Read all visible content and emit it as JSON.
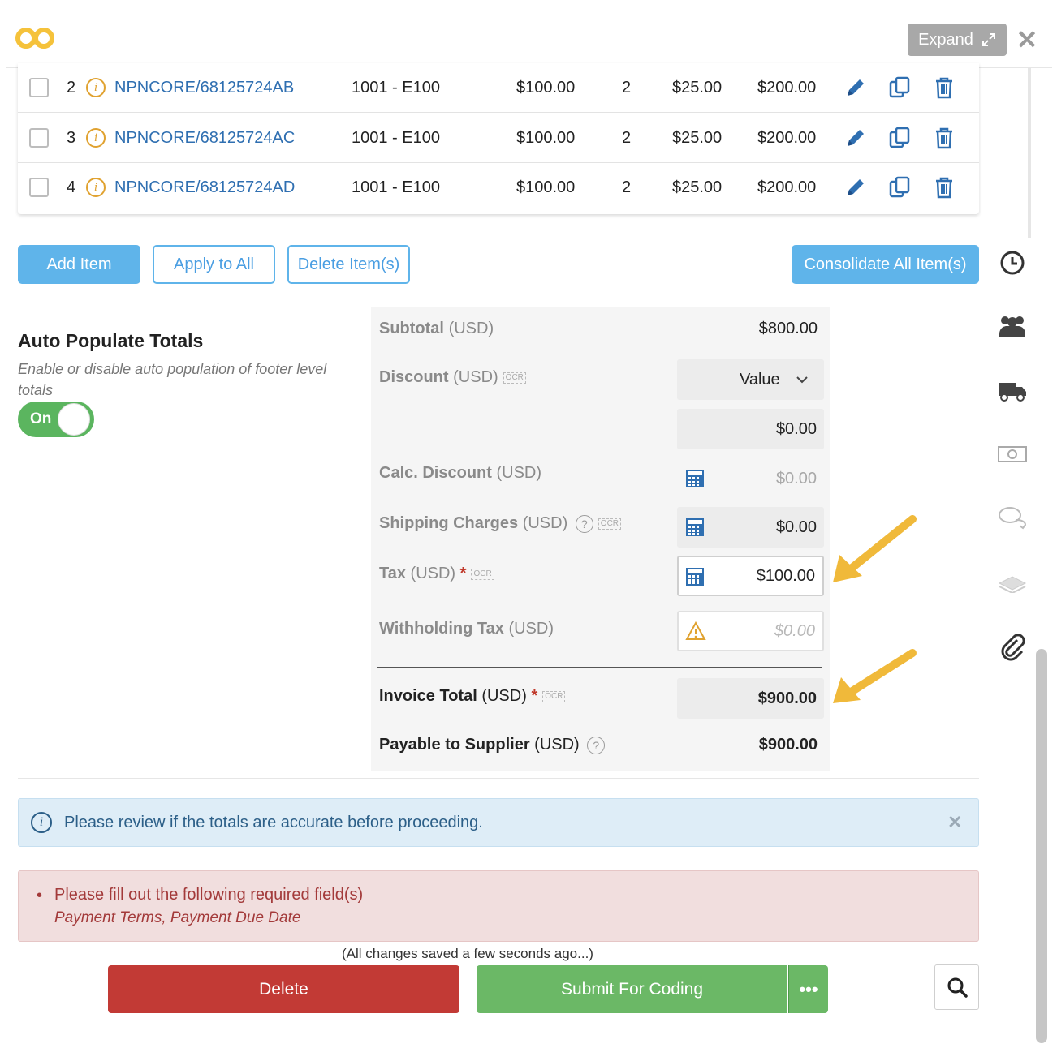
{
  "header": {
    "expand_label": "Expand",
    "icons": {
      "logo": "infinity-logo",
      "expand": "expand-arrows-icon",
      "close": "close-icon"
    }
  },
  "items": [
    {
      "num": "2",
      "ref": "NPNCORE/68125724AB",
      "account": "1001 - E100",
      "price": "$100.00",
      "qty": "2",
      "unit": "$25.00",
      "total": "$200.00"
    },
    {
      "num": "3",
      "ref": "NPNCORE/68125724AC",
      "account": "1001 - E100",
      "price": "$100.00",
      "qty": "2",
      "unit": "$25.00",
      "total": "$200.00"
    },
    {
      "num": "4",
      "ref": "NPNCORE/68125724AD",
      "account": "1001 - E100",
      "price": "$100.00",
      "qty": "2",
      "unit": "$25.00",
      "total": "$200.00"
    }
  ],
  "actions": {
    "add_item": "Add Item",
    "apply_to_all": "Apply to All",
    "delete_items": "Delete Item(s)",
    "consolidate": "Consolidate All Item(s)"
  },
  "auto_populate": {
    "title": "Auto Populate Totals",
    "description": "Enable or disable auto population of footer level totals",
    "toggle_label": "On"
  },
  "totals": {
    "subtotal_label": "Subtotal",
    "subtotal_currency": "(USD)",
    "subtotal_value": "$800.00",
    "discount_label": "Discount",
    "discount_currency": "(USD)",
    "discount_type": "Value",
    "discount_value": "$0.00",
    "calc_discount_label": "Calc. Discount",
    "calc_discount_currency": "(USD)",
    "calc_discount_value": "$0.00",
    "shipping_label": "Shipping Charges",
    "shipping_currency": "(USD)",
    "shipping_value": "$0.00",
    "tax_label": "Tax",
    "tax_currency": "(USD)",
    "tax_value": "$100.00",
    "withholding_label": "Withholding Tax",
    "withholding_currency": "(USD)",
    "withholding_placeholder": "$0.00",
    "invoice_total_label": "Invoice Total",
    "invoice_total_currency": "(USD)",
    "invoice_total_value": "$900.00",
    "payable_label": "Payable to Supplier",
    "payable_currency": "(USD)",
    "payable_value": "$900.00",
    "ocr_tag": "OCR",
    "help_mark": "?",
    "required_mark": "*"
  },
  "alerts": {
    "info": "Please review if the totals are accurate before proceeding.",
    "error_line1": "Please fill out the following required field(s)",
    "error_line2": "Payment Terms, Payment Due Date"
  },
  "footer": {
    "saved_status": "(All changes saved a few seconds ago...)",
    "delete_label": "Delete",
    "submit_label": "Submit For Coding",
    "more_label": "•••"
  },
  "sidebar_icons": [
    "clock-icon",
    "users-icon",
    "truck-icon",
    "money-icon",
    "comments-icon",
    "stack-icon",
    "paperclip-icon"
  ],
  "colors": {
    "link": "#2f6fb1",
    "primary": "#5fb4ea",
    "success": "#6bb866",
    "danger": "#c23a35",
    "warning": "#e0a230",
    "arrow": "#f0b93a"
  }
}
